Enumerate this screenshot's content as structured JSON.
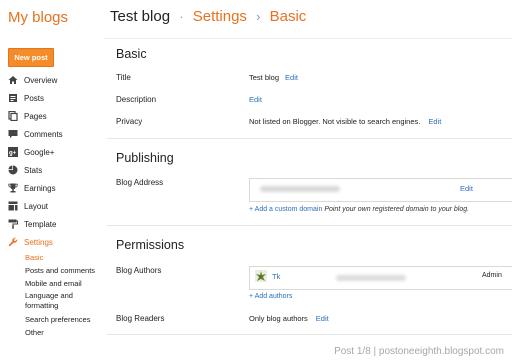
{
  "header": {
    "brand": "My blogs",
    "blog_name": "Test blog",
    "separator1": "·",
    "crumb_settings": "Settings",
    "separator2": "›",
    "crumb_basic": "Basic"
  },
  "sidebar": {
    "new_post": "New post",
    "items": [
      {
        "label": "Overview",
        "icon": "home-icon"
      },
      {
        "label": "Posts",
        "icon": "posts-icon"
      },
      {
        "label": "Pages",
        "icon": "pages-icon"
      },
      {
        "label": "Comments",
        "icon": "comment-icon"
      },
      {
        "label": "Google+",
        "icon": "google-plus-icon"
      },
      {
        "label": "Stats",
        "icon": "pie-chart-icon"
      },
      {
        "label": "Earnings",
        "icon": "trophy-icon"
      },
      {
        "label": "Layout",
        "icon": "layout-icon"
      },
      {
        "label": "Template",
        "icon": "paint-roller-icon"
      },
      {
        "label": "Settings",
        "icon": "wrench-icon",
        "active": true
      }
    ],
    "subitems": [
      {
        "label": "Basic",
        "active": true
      },
      {
        "label": "Posts and comments"
      },
      {
        "label": "Mobile and email"
      },
      {
        "label": "Language and formatting"
      },
      {
        "label": "Search preferences"
      },
      {
        "label": "Other"
      }
    ]
  },
  "basic": {
    "title": "Basic",
    "title_label": "Title",
    "title_value": "Test blog",
    "title_edit": "Edit",
    "description_label": "Description",
    "description_edit": "Edit",
    "privacy_label": "Privacy",
    "privacy_value": "Not listed on Blogger. Not visible to search engines.",
    "privacy_edit": "Edit"
  },
  "publishing": {
    "title": "Publishing",
    "address_label": "Blog Address",
    "address_edit": "Edit",
    "add_domain": "+ Add a custom domain",
    "add_domain_help": "Point your own registered domain to your blog."
  },
  "permissions": {
    "title": "Permissions",
    "authors_label": "Blog Authors",
    "author_name": "Tk",
    "author_role": "Admin",
    "add_authors": "+ Add authors",
    "readers_label": "Blog Readers",
    "readers_value": "Only blog authors",
    "readers_edit": "Edit"
  },
  "watermark": "Post 1/8 | postoneeighth.blogspot.com",
  "colors": {
    "accent": "#e8711d",
    "link": "#2e6fbd",
    "button": "#f58c2a"
  }
}
